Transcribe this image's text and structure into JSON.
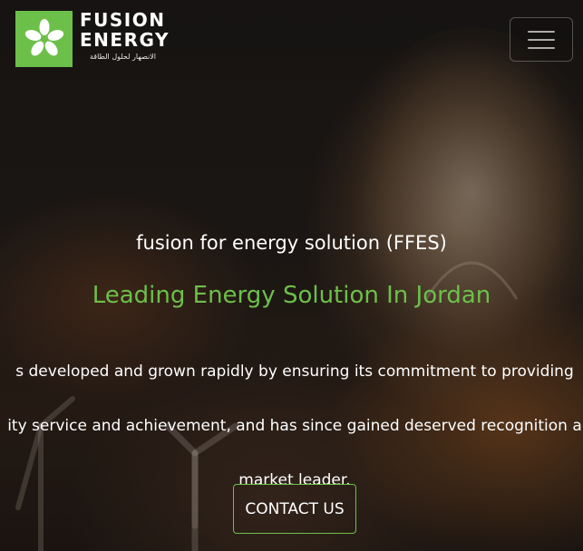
{
  "brand": {
    "line1": "FUSION",
    "line2": "ENERGY",
    "tagline_ar": "الانصهار لحلول الطاقة",
    "logo_icon": "leaf-flower-icon",
    "accent_color": "#6cc04a"
  },
  "nav": {
    "menu_icon": "hamburger-menu-icon"
  },
  "hero": {
    "subtitle": "fusion for energy solution (FFES)",
    "headline": "Leading Energy Solution In Jordan",
    "description": "s developed and grown rapidly by ensuring its commitment to providing ity service and achievement, and has since gained deserved recognition a market leader.",
    "description_lines": [
      "s developed and grown rapidly by ensuring its commitment to providing",
      "ity service and achievement, and has since gained deserved recognition a",
      "market leader."
    ],
    "cta_label": "CONTACT US"
  }
}
